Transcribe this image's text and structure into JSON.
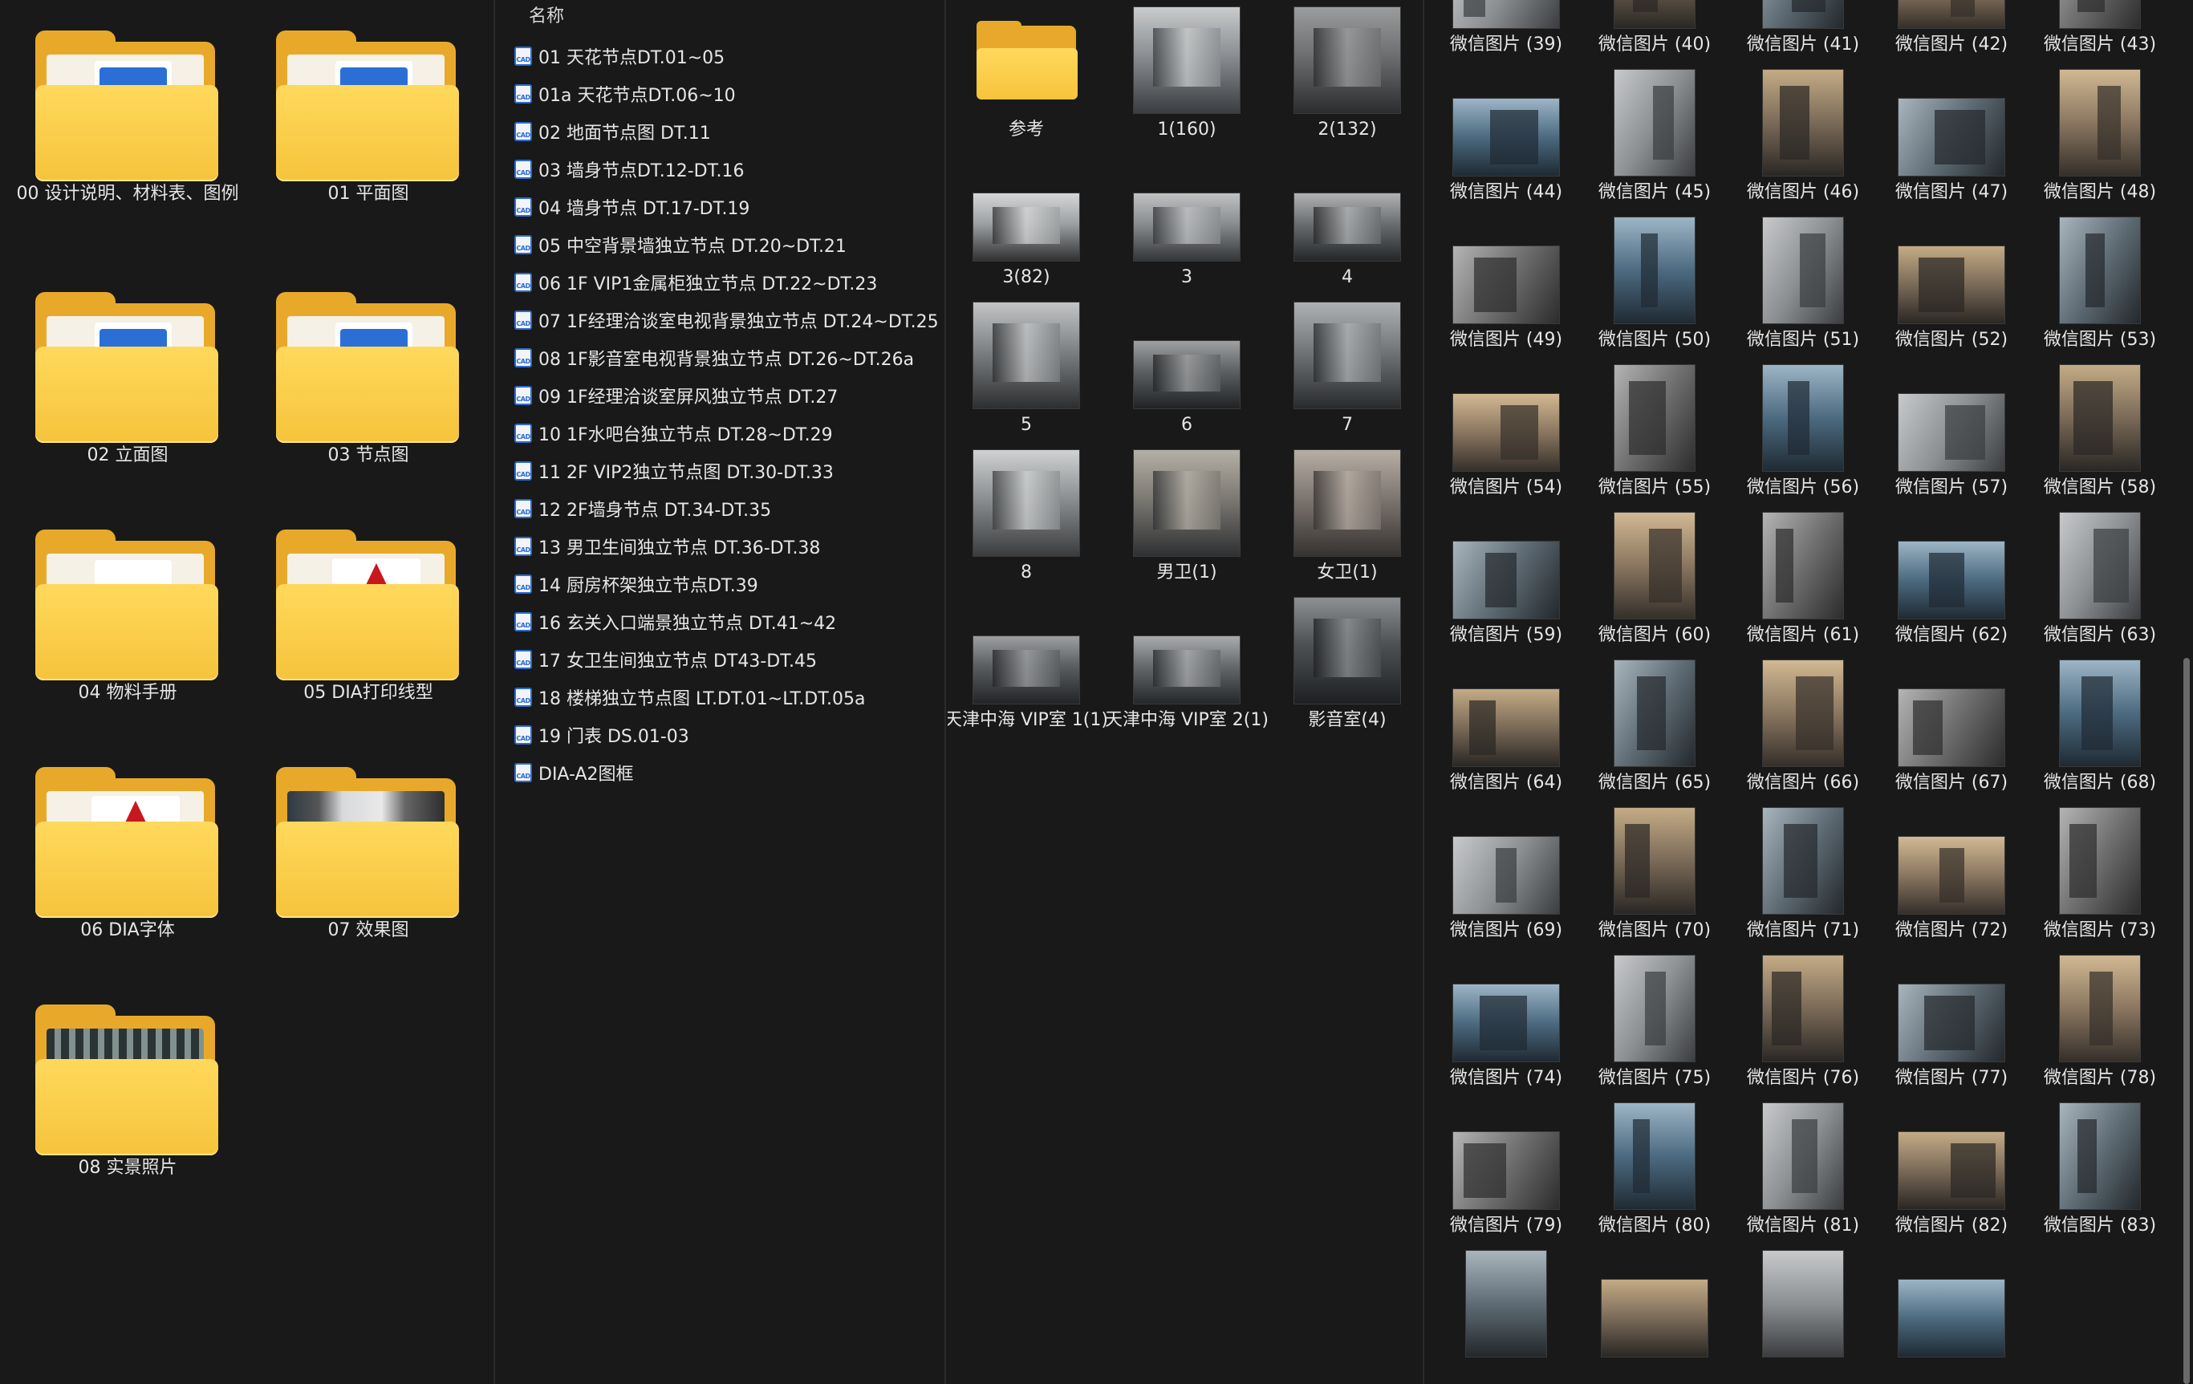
{
  "folders": [
    {
      "label": "00  设计说明、材料表、图例",
      "type": "cad"
    },
    {
      "label": "01 平面图",
      "type": "cad"
    },
    {
      "label": "02  立面图",
      "type": "cad"
    },
    {
      "label": "03 节点图",
      "type": "cad"
    },
    {
      "label": "04 物料手册",
      "type": "pdf"
    },
    {
      "label": "05 DIA打印线型",
      "type": "acrobat"
    },
    {
      "label": "06 DIA字体",
      "type": "acrobat"
    },
    {
      "label": "07 效果图",
      "type": "photo"
    },
    {
      "label": "08 实景照片",
      "type": "photo2"
    }
  ],
  "file_list": {
    "header": "名称",
    "sort_glyph": "^",
    "files": [
      "01 天花节点DT.01~05",
      "01a 天花节点DT.06~10",
      "02 地面节点图 DT.11",
      "03 墙身节点DT.12-DT.16",
      "04 墙身节点 DT.17-DT.19",
      "05 中空背景墙独立节点 DT.20~DT.21",
      "06 1F VIP1金属柜独立节点 DT.22~DT.23",
      "07 1F经理洽谈室电视背景独立节点 DT.24~DT.25",
      "08 1F影音室电视背景独立节点 DT.26~DT.26a",
      "09 1F经理洽谈室屏风独立节点 DT.27",
      "10 1F水吧台独立节点 DT.28~DT.29",
      "11 2F VIP2独立节点图 DT.30-DT.33",
      "12 2F墙身节点 DT.34-DT.35",
      "13 男卫生间独立节点 DT.36-DT.38",
      "14 厨房杯架独立节点DT.39",
      "16 玄关入口端景独立节点 DT.41~42",
      "17 女卫生间独立节点 DT43-DT.45",
      "18 楼梯独立节点图 LT.DT.01~LT.DT.05a",
      "19 门表 DS.01-03",
      "DIA-A2图框"
    ]
  },
  "renderings": [
    {
      "label": "参考",
      "folder": true
    },
    {
      "label": "1(160)",
      "tone": [
        "#3a3d40",
        "#8b8e92",
        "#c9cbcc"
      ],
      "ratio": "portrait"
    },
    {
      "label": "2(132)",
      "tone": [
        "#2a2c2e",
        "#6d6f70",
        "#9a9c9d"
      ],
      "ratio": "portrait"
    },
    {
      "label": "3(82)",
      "tone": [
        "#2f3133",
        "#9da0a2",
        "#d5d6d7"
      ],
      "ratio": "landscape"
    },
    {
      "label": "3",
      "tone": [
        "#333538",
        "#8a8d90",
        "#bfc1c3"
      ],
      "ratio": "landscape"
    },
    {
      "label": "4",
      "tone": [
        "#242628",
        "#6b6e70",
        "#b0b2b4"
      ],
      "ratio": "landscape"
    },
    {
      "label": "5",
      "tone": [
        "#2c2e30",
        "#7f8284",
        "#c2c4c6"
      ],
      "ratio": "portrait"
    },
    {
      "label": "6",
      "tone": [
        "#202224",
        "#5d6062",
        "#9ea0a2"
      ],
      "ratio": "landscape"
    },
    {
      "label": "7",
      "tone": [
        "#282a2c",
        "#74777a",
        "#aeb1b3"
      ],
      "ratio": "portrait"
    },
    {
      "label": "8",
      "tone": [
        "#3a3c3e",
        "#8d9092",
        "#cfd1d2"
      ],
      "ratio": "portrait"
    },
    {
      "label": "男卫(1)",
      "tone": [
        "#2e3032",
        "#7d7a74",
        "#b5b0a6"
      ],
      "ratio": "portrait"
    },
    {
      "label": "女卫(1)",
      "tone": [
        "#353230",
        "#7e7670",
        "#b7aea4"
      ],
      "ratio": "portrait"
    },
    {
      "label": "天津中海 VIP室 1(1)",
      "tone": [
        "#222426",
        "#5a5d60",
        "#9d9fa1"
      ],
      "ratio": "landscape"
    },
    {
      "label": "天津中海 VIP室 2(1)",
      "tone": [
        "#25282a",
        "#65686b",
        "#a9abad"
      ],
      "ratio": "landscape"
    },
    {
      "label": "影音室(4)",
      "tone": [
        "#1d1f21",
        "#4d5053",
        "#8d9093"
      ],
      "ratio": "portrait"
    }
  ],
  "photos": {
    "label_prefix": "微信图片",
    "items": [
      "微信图片 (39)",
      "微信图片 (40)",
      "微信图片 (41)",
      "微信图片 (42)",
      "微信图片 (43)",
      "微信图片 (44)",
      "微信图片 (45)",
      "微信图片 (46)",
      "微信图片 (47)",
      "微信图片 (48)",
      "微信图片 (49)",
      "微信图片 (50)",
      "微信图片 (51)",
      "微信图片 (52)",
      "微信图片 (53)",
      "微信图片 (54)",
      "微信图片 (55)",
      "微信图片 (56)",
      "微信图片 (57)",
      "微信图片 (58)",
      "微信图片 (59)",
      "微信图片 (60)",
      "微信图片 (61)",
      "微信图片 (62)",
      "微信图片 (63)",
      "微信图片 (64)",
      "微信图片 (65)",
      "微信图片 (66)",
      "微信图片 (67)",
      "微信图片 (68)",
      "微信图片 (69)",
      "微信图片 (70)",
      "微信图片 (71)",
      "微信图片 (72)",
      "微信图片 (73)",
      "微信图片 (74)",
      "微信图片 (75)",
      "微信图片 (76)",
      "微信图片 (77)",
      "微信图片 (78)",
      "微信图片 (79)",
      "微信图片 (80)",
      "微信图片 (81)",
      "微信图片 (82)",
      "微信图片 (83)"
    ],
    "partial_row_count": 4
  },
  "colors": {
    "background": "#191919",
    "text": "#e6e6e6",
    "folder_yellow": "#f6c33b",
    "cad_blue": "#2a6bd1",
    "acrobat_red": "#c9171e"
  }
}
